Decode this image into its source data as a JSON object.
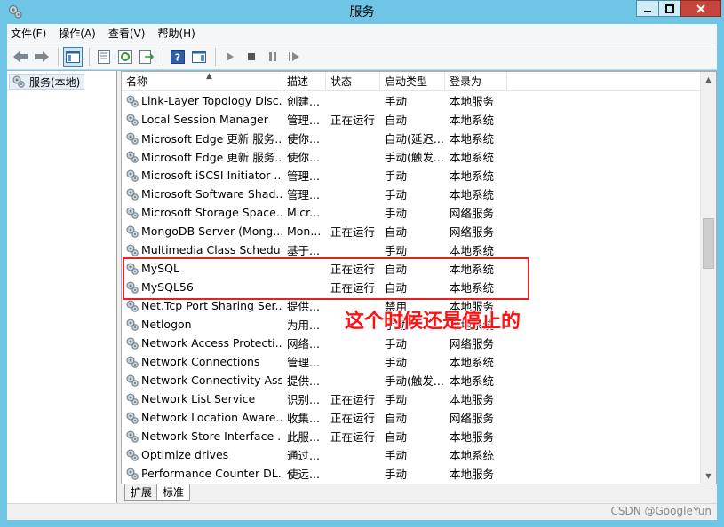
{
  "window": {
    "title": "服务"
  },
  "menu": [
    "文件(F)",
    "操作(A)",
    "查看(V)",
    "帮助(H)"
  ],
  "tree": {
    "root_label": "服务(本地)"
  },
  "columns": {
    "name": "名称",
    "desc": "描述",
    "status": "状态",
    "startup": "启动类型",
    "logon": "登录为"
  },
  "services": [
    {
      "name": "Link-Layer Topology Disc...",
      "desc": "创建...",
      "status": "",
      "startup": "手动",
      "logon": "本地服务"
    },
    {
      "name": "Local Session Manager",
      "desc": "管理...",
      "status": "正在运行",
      "startup": "自动",
      "logon": "本地系统"
    },
    {
      "name": "Microsoft Edge 更新 服务...",
      "desc": "使你...",
      "status": "",
      "startup": "自动(延迟...",
      "logon": "本地系统"
    },
    {
      "name": "Microsoft Edge 更新 服务...",
      "desc": "使你...",
      "status": "",
      "startup": "手动(触发...",
      "logon": "本地系统"
    },
    {
      "name": "Microsoft iSCSI Initiator ...",
      "desc": "管理...",
      "status": "",
      "startup": "手动",
      "logon": "本地系统"
    },
    {
      "name": "Microsoft Software Shad...",
      "desc": "管理...",
      "status": "",
      "startup": "手动",
      "logon": "本地系统"
    },
    {
      "name": "Microsoft Storage Space...",
      "desc": "Micr...",
      "status": "",
      "startup": "手动",
      "logon": "网络服务"
    },
    {
      "name": "MongoDB Server (Mong...",
      "desc": "Mon...",
      "status": "正在运行",
      "startup": "自动",
      "logon": "网络服务"
    },
    {
      "name": "Multimedia Class Schedu...",
      "desc": "基于...",
      "status": "",
      "startup": "手动",
      "logon": "本地系统"
    },
    {
      "name": "MySQL",
      "desc": "",
      "status": "正在运行",
      "startup": "自动",
      "logon": "本地系统"
    },
    {
      "name": "MySQL56",
      "desc": "",
      "status": "正在运行",
      "startup": "自动",
      "logon": "本地系统"
    },
    {
      "name": "Net.Tcp Port Sharing Ser...",
      "desc": "提供...",
      "status": "",
      "startup": "禁用",
      "logon": "本地服务"
    },
    {
      "name": "Netlogon",
      "desc": "为用...",
      "status": "",
      "startup": "手动",
      "logon": "本地系统"
    },
    {
      "name": "Network Access Protecti...",
      "desc": "网络...",
      "status": "",
      "startup": "手动",
      "logon": "网络服务"
    },
    {
      "name": "Network Connections",
      "desc": "管理...",
      "status": "",
      "startup": "手动",
      "logon": "本地系统"
    },
    {
      "name": "Network Connectivity Ass...",
      "desc": "提供...",
      "status": "",
      "startup": "手动(触发...",
      "logon": "本地系统"
    },
    {
      "name": "Network List Service",
      "desc": "识别...",
      "status": "正在运行",
      "startup": "手动",
      "logon": "本地服务"
    },
    {
      "name": "Network Location Aware...",
      "desc": "收集...",
      "status": "正在运行",
      "startup": "自动",
      "logon": "网络服务"
    },
    {
      "name": "Network Store Interface ...",
      "desc": "此服...",
      "status": "正在运行",
      "startup": "自动",
      "logon": "本地服务"
    },
    {
      "name": "Optimize drives",
      "desc": "通过...",
      "status": "",
      "startup": "手动",
      "logon": "本地系统"
    },
    {
      "name": "Performance Counter DL...",
      "desc": "使远...",
      "status": "",
      "startup": "手动",
      "logon": "本地服务"
    }
  ],
  "tabs": {
    "extended": "扩展",
    "standard": "标准"
  },
  "annotation": {
    "text": "这个时候还是停止的",
    "color": "#ff1010"
  },
  "watermark": "CSDN @GoogleYun",
  "colors": {
    "titlebar": "#6fc5e6",
    "highlight": "#e52222"
  }
}
